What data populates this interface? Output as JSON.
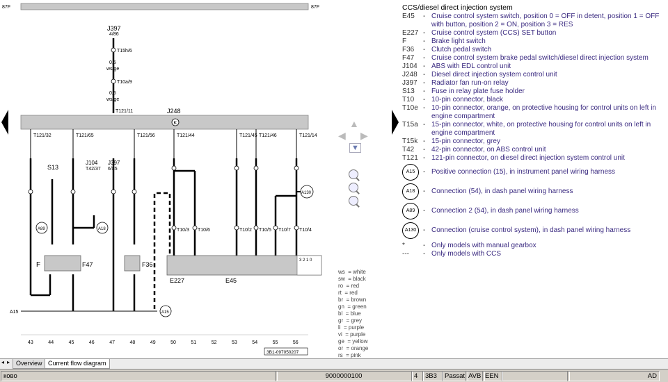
{
  "legend": {
    "title": "CCS/diesel direct injection system",
    "rows": [
      {
        "code": "E45",
        "desc": "Cruise control system switch, position 0 = OFF in detent, position 1 = OFF with button, position 2 = ON, position 3 = RES"
      },
      {
        "code": "E227",
        "desc": "Cruise control system (CCS) SET button"
      },
      {
        "code": "F",
        "desc": "Brake light switch"
      },
      {
        "code": "F36",
        "desc": "Clutch pedal switch"
      },
      {
        "code": "F47",
        "desc": "Cruise control system brake pedal switch/diesel direct injection system"
      },
      {
        "code": "J104",
        "desc": "ABS with EDL control unit"
      },
      {
        "code": "J248",
        "desc": "Diesel direct injection system control unit"
      },
      {
        "code": "J397",
        "desc": "Radiator fan run-on relay"
      },
      {
        "code": "S13",
        "desc": "Fuse in relay plate fuse holder"
      },
      {
        "code": "T10",
        "desc": "10-pin connector, black"
      },
      {
        "code": "T10e",
        "desc": "10-pin connector, orange, on protective housing for control units on left in engine compartment"
      },
      {
        "code": "T15a",
        "desc": "15-pin connector, white, on protective housing for control units on left in engine compartment"
      },
      {
        "code": "T15k",
        "desc": "15-pin connector, grey"
      },
      {
        "code": "T42",
        "desc": "42-pin connector, on ABS control unit"
      },
      {
        "code": "T121",
        "desc": "121-pin connector, on diesel direct injection system control unit"
      }
    ],
    "circle_rows": [
      {
        "code": "A15",
        "desc": "Positive connection (15), in instrument panel wiring harness"
      },
      {
        "code": "A18",
        "desc": "Connection (54), in dash panel wiring harness"
      },
      {
        "code": "A89",
        "desc": "Connection 2 (54), in dash panel wiring harness"
      },
      {
        "code": "A130",
        "desc": "Connection (cruise control system), in dash panel wiring harness"
      }
    ],
    "notes": [
      {
        "code": "*",
        "desc": "Only models with manual gearbox"
      },
      {
        "code": "---",
        "desc": "Only models with CCS"
      }
    ]
  },
  "wire_colors": [
    "ws  = white",
    "sw  = black",
    "ro  = red",
    "rt  = red",
    "br  = brown",
    "gn  = green",
    "bl  = blue",
    "gr  = grey",
    "li  = purple",
    "vi  = purple",
    "ge  = yellow",
    "or  = orange",
    "rs  = pink"
  ],
  "diagram": {
    "top_rail_left": "87F",
    "top_rail_right": "87F",
    "j397_top": "J397",
    "j397_top_pin": "4/86",
    "t15h": "T15h/6",
    "t10a": "T10a/9",
    "w1_size": "0,5",
    "w1_color": "ws/ge",
    "w2_size": "0,5",
    "w2_color": "ws/ge",
    "t121_11": "T121/11",
    "j248": "J248",
    "k_symbol": "K",
    "pins_top": [
      "T121/32",
      "T121/65",
      "T121/56",
      "T121/44",
      "T121/45",
      "T121/46",
      "T121/14"
    ],
    "s13": "S13",
    "j104": "J104",
    "j104_pin": "T42/37",
    "j397b": "J397",
    "j397b_pin": "6/85",
    "e227": "E227",
    "e45": "E45",
    "f": "F",
    "f47": "F47",
    "f36": "F36",
    "a15_rail": "A15",
    "a15_circ": "A15",
    "a89": "A89",
    "a18": "A18",
    "a130": "A130",
    "col_numbers": [
      "43",
      "44",
      "45",
      "46",
      "47",
      "48",
      "49",
      "50",
      "51",
      "52",
      "53",
      "54",
      "55",
      "56"
    ],
    "t10_labels": [
      "T10/3",
      "T10/6",
      "T10/2",
      "T10/5",
      "T10/7",
      "T10/4"
    ],
    "conn_id": "3B1-097050207"
  },
  "tabs": [
    {
      "label": "Overview",
      "active": false
    },
    {
      "label": "Current flow diagram",
      "active": true
    }
  ],
  "status": {
    "left": "ково",
    "number": "9000000100",
    "f1": "4",
    "f2": "3B3",
    "f3": "Passat",
    "f4": "AVB",
    "f5": "EEN",
    "right": "AD"
  }
}
